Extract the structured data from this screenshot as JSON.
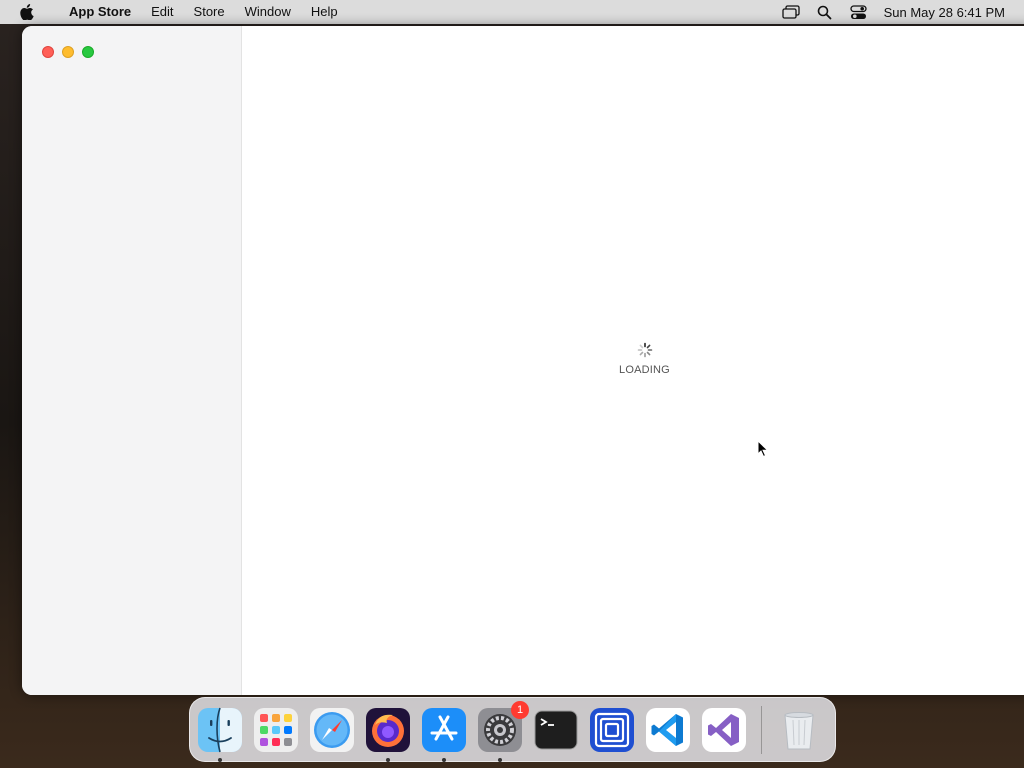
{
  "menubar": {
    "app_name": "App Store",
    "menus": [
      "Edit",
      "Store",
      "Window",
      "Help"
    ],
    "clock": "Sun May 28  6:41 PM",
    "status_icons": [
      "screen-mirroring-icon",
      "spotlight-search-icon",
      "control-center-icon"
    ]
  },
  "window": {
    "loading_label": "LOADING"
  },
  "dock": {
    "apps": [
      {
        "name": "Finder",
        "icon": "finder-icon",
        "running": true
      },
      {
        "name": "Launchpad",
        "icon": "launchpad-icon",
        "running": false
      },
      {
        "name": "Safari",
        "icon": "safari-icon",
        "running": false
      },
      {
        "name": "Firefox",
        "icon": "firefox-icon",
        "running": true
      },
      {
        "name": "App Store",
        "icon": "app-store-icon",
        "running": true
      },
      {
        "name": "System Preferences",
        "icon": "system-preferences-icon",
        "running": true,
        "badge": "1"
      },
      {
        "name": "Terminal",
        "icon": "terminal-icon",
        "running": false
      },
      {
        "name": "Screen Sharing",
        "icon": "screen-sharing-icon",
        "running": false
      },
      {
        "name": "Visual Studio Code",
        "icon": "vscode-icon",
        "running": false
      },
      {
        "name": "Visual Studio",
        "icon": "visual-studio-icon",
        "running": false
      }
    ],
    "trash": {
      "name": "Trash",
      "icon": "trash-icon"
    }
  }
}
